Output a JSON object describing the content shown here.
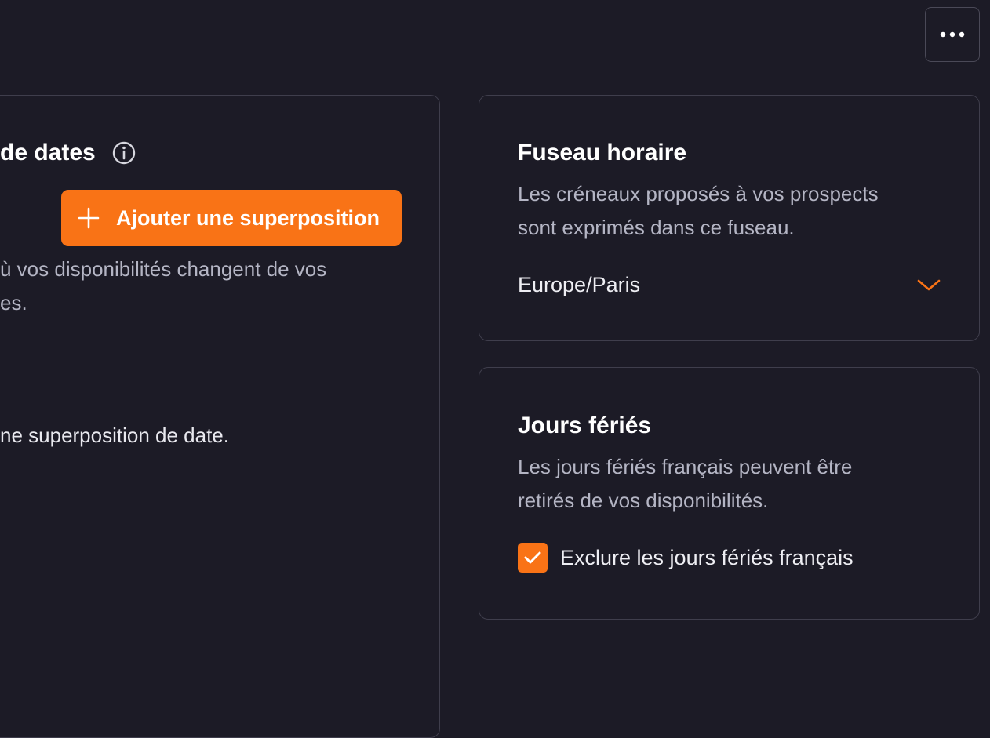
{
  "toolbar": {
    "more_icon": "ellipsis-horizontal-icon"
  },
  "overrides": {
    "title": "de dates",
    "info_icon": "info-circle-icon",
    "add_button_label": "Ajouter une superposition",
    "add_icon": "plus-icon",
    "description_line1": "ù vos disponibilités changent de vos",
    "description_line2": "es.",
    "empty_text": "ne superposition de date."
  },
  "timezone": {
    "title": "Fuseau horaire",
    "description_line1": "Les créneaux proposés à vos prospects",
    "description_line2": "sont exprimés dans ce fuseau.",
    "selected_value": "Europe/Paris",
    "dropdown_icon": "chevron-down-icon"
  },
  "holidays": {
    "title": "Jours fériés",
    "description_line1": "Les jours fériés français peuvent être",
    "description_line2": "retirés de vos disponibilités.",
    "checkbox_label": "Exclure les jours fériés français",
    "checkbox_checked": true,
    "check_icon": "checkmark-icon"
  },
  "colors": {
    "background": "#1c1b26",
    "accent": "#f97316",
    "border": "#3f3e4c",
    "muted_text": "#b4b5c4"
  }
}
